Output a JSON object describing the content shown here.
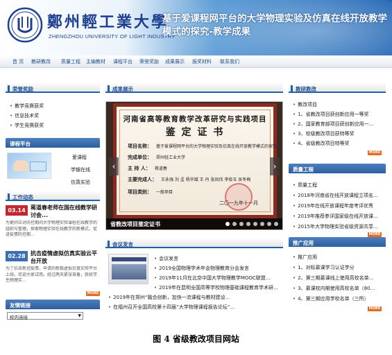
{
  "header": {
    "school_name_cn": "鄭州輕工業大學",
    "school_name_en": "ZHENGZHOU UNIVERSITY OF LIGHT INDUSTRY",
    "project_title": "基于爱课程网平台的大学物理实验及仿真在线开放教学模式的探究-教学成果"
  },
  "nav": [
    "首 页",
    "教研教改",
    "质量工程",
    "主编教材",
    "课程平台",
    "荣誉奖励",
    "成果展示",
    "报奖材料",
    "联系我们"
  ],
  "left": {
    "honors": {
      "title": "荣誉奖励",
      "items": [
        "教学竞赛获奖",
        "信息技术奖",
        "学生竞赛获奖"
      ]
    },
    "platform": {
      "title": "课程平台",
      "links": [
        "爱课程",
        "学银在线",
        "仿真实验"
      ]
    },
    "news": {
      "title": "工作动态",
      "items": [
        {
          "date": "03.14",
          "title": "蒋道春老师在国在线教学研讨会...",
          "body": "为更好应对防控期间大学物理实验课程在线教学的组织与管理，探索物理实验在线教学的新模式，促进疫情防控期..."
        },
        {
          "date": "02.28",
          "title": "抗击疫情虚拟仿真实验云平台开放",
          "body": "为了抗击新冠疫情，申请的新数虚拟仿真实验平台上线，欢迎大家试用。经过两天紧张准备，我校学生物理实..."
        }
      ],
      "more": "MORE"
    },
    "friend_links": {
      "title": "友情链接",
      "select_value": "校内连接"
    }
  },
  "center": {
    "showcase": {
      "title": "成果展示",
      "caption": "省教改项目鉴定证书",
      "certificate": {
        "line1": "河南省高等教育教学改革研究与实践项目",
        "line2": "鉴 定 证 书",
        "rows": [
          {
            "label": "项目名称：",
            "value": "基于爱课程网平台的大学物理实验及仿真在线开放教学模式的探究"
          },
          {
            "label": "完成单位：",
            "value": "郑州轻工业大学"
          },
          {
            "label": "主 持 人：",
            "value": "蒋道春"
          },
          {
            "label": "主要完成人：",
            "value": "王永强  刘 孟  杨华斌  王 丹  张凤伟  李俊玉  吴冬梅"
          },
          {
            "label": "项目类别：",
            "value": "一般项目"
          }
        ],
        "date": "二〇一九年十一月"
      },
      "slide_count": 8,
      "active_slide": 0
    },
    "meetings": {
      "title": "会议发言",
      "items": [
        "会议发言",
        "2019全国物理学术年会物理教育分会发言",
        "2019年11月在北京中国大学物理教学MOOC联盟...",
        "2019年在昆明全国高等学校物理基础课程教育学术研...",
        "2019年在郑州“融合创新，加快一流课程与教材建设...",
        "在福州召开全国高校第十四届“大学物理课程报告论坛”..."
      ],
      "more": "MORE"
    }
  },
  "right": {
    "reform": {
      "title": "教研教改",
      "items": [
        "教改项目",
        "1、省教改项目获创新应用一等奖",
        "2、国家教育部项目获创新应用一...",
        "3、校级教改项目获特等奖",
        "4、省级教改项目特等奖"
      ],
      "more": "MORE"
    },
    "quality": {
      "title": "质量工程",
      "items": [
        "质量工程",
        "2018年河南省在线开放课程立项名...",
        "2019年在线开放课程年度考评优秀",
        "2019年推荐参评国家级在线开放课...",
        "2015年大学物理实验省级资源共享..."
      ],
      "more": "MORE"
    },
    "application": {
      "title": "推广应用",
      "items": [
        "推广应用",
        "1、对标慕课学习认证学分",
        "2、第三期慕课线上使用高校名单...",
        "3、慕课校内期使用高校名单（80...",
        "4、第三期应用学校名单（三所）"
      ],
      "more": "MORE"
    }
  },
  "figure_caption": "图 4 省级教改项目网站"
}
